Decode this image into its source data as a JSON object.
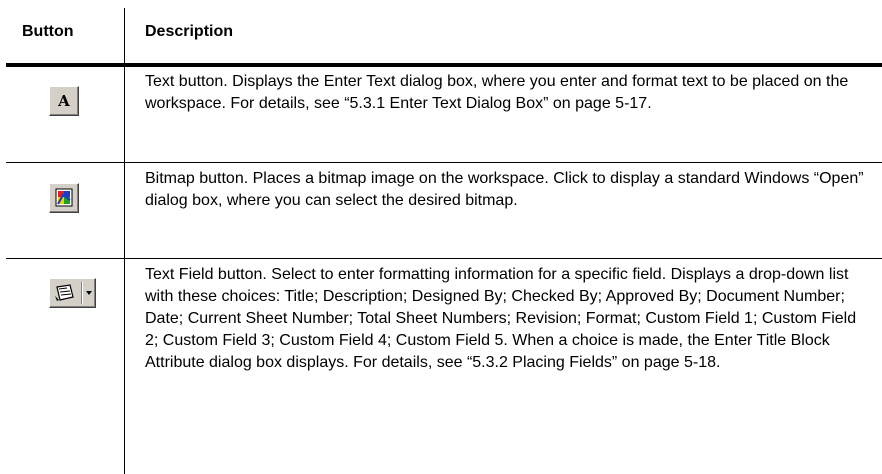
{
  "header": {
    "button_col": "Button",
    "description_col": "Description"
  },
  "rows": [
    {
      "icon": "text-a-icon",
      "description": "Text button. Displays the Enter Text dialog box, where you enter and format text to be placed on the workspace. For details, see “5.3.1 Enter Text Dialog Box” on page 5-17."
    },
    {
      "icon": "bitmap-icon",
      "description": "Bitmap button. Places a bitmap image on the workspace. Click to display a standard Windows “Open” dialog box, where you can select the desired bitmap."
    },
    {
      "icon": "text-field-icon",
      "description": "Text Field button. Select to enter formatting information for a specific field. Displays a drop-down list with these choices: Title; Description; Designed By; Checked By; Approved By; Document Number; Date; Current Sheet Number; Total Sheet Numbers; Revision; Format; Custom Field 1; Custom Field 2; Custom Field 3; Custom Field 4; Custom Field 5. When a choice is made, the Enter Title Block Attribute dialog box displays. For details, see “5.3.2 Placing Fields” on page 5-18."
    }
  ],
  "icon_glyphs": {
    "text_button": "A"
  },
  "colors": {
    "button_face": "#d4d0c8",
    "bitmap_red": "#e02020",
    "bitmap_blue": "#1a3cc8",
    "bitmap_yellow": "#f0d000",
    "bitmap_green": "#20a020"
  }
}
